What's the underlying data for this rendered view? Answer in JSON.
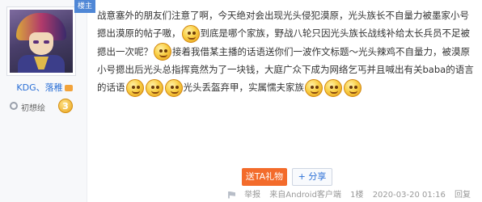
{
  "floor_tag": "楼主",
  "user": {
    "name_prefix": "KDG、",
    "name": "落稚",
    "level_label": "初想绘",
    "level": "3"
  },
  "content": {
    "line1": "战意塞外的朋友们注意了啊，今天绝对会出现光头侵犯漠原，光头族长不自量力被墨家小号",
    "line2a": "摁出漠原的帖子嗷，",
    "line2b": "到底是哪个家族，野战八轮只因光头族长战线补给太长兵员不足被",
    "line3a": "摁出一次呢？",
    "line3b": "接着我借某主播的话语送你们一波作文标题～光头辣鸡不自量力，被漠原",
    "line4": "小号摁出后光头总指挥竟然为了一块钱，大庭广众下成为网络乞丐并且喊出有关baba的语言",
    "line5a": "的话语",
    "line5b": "光头丢盔弃甲，实属懦夫家族"
  },
  "actions": {
    "gift_label": "送TA礼物",
    "share_label": "分享"
  },
  "footer": {
    "report_label": "举报",
    "client": "来自Android客户端",
    "floor": "1楼",
    "timestamp": "2020-03-20 01:16",
    "reply_label": "回复"
  },
  "colors": {
    "accent": "#2a6fd6",
    "gift": "#f36b2b"
  }
}
